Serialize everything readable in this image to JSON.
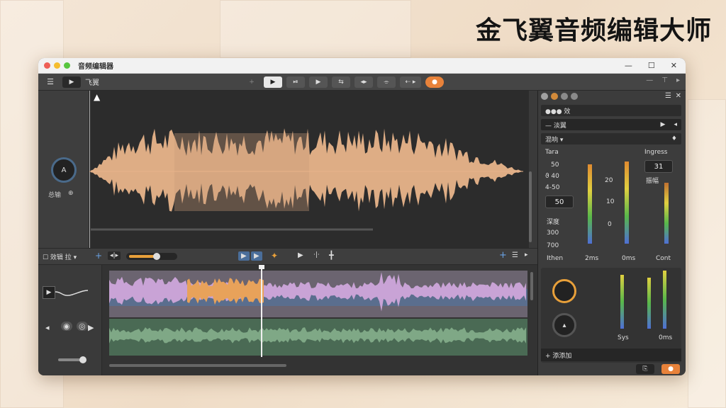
{
  "headline": "金飞翼音频编辑大师",
  "window": {
    "title": "音频编辑器",
    "controls": [
      "—",
      "☐",
      "✕"
    ],
    "traffic_colors": [
      "#ee5f57",
      "#f5bd2f",
      "#58c53e"
    ]
  },
  "toolbar": {
    "menu_icon": "☰",
    "play_icon": "▶",
    "label": "飞翼",
    "add_icon": "+",
    "tools": [
      "▶",
      "⏯",
      "▶",
      "⇆",
      "◂▸",
      "⌯",
      "⇠ ▸",
      "●"
    ],
    "right_tools": [
      "—",
      "⊤",
      "▸"
    ]
  },
  "waveform": {
    "marker_icon": "▲",
    "knob_label": "A",
    "knob_caption": "总输",
    "knob_icon": "⊕",
    "color": "#e8b48a",
    "highlight_color": "#c99a78"
  },
  "right_panel": {
    "header_dots": [
      "#a0a0a0",
      "#d28a3a",
      "#9a9a9a",
      "#9a9a9a"
    ],
    "header_icons": [
      "☰",
      "✕"
    ],
    "row1_label": "●●● 效",
    "row2_label": "— 淡翼",
    "row2_btns": [
      "▶",
      "◂"
    ],
    "row3_label": "混响 ▾",
    "row3_icon": "♦",
    "params": {
      "left_title": "Tara",
      "right_title": "Ingress",
      "v1": "50",
      "v2": "ϑ 40",
      "v3": "4-50",
      "box1": "50",
      "v4": "深度",
      "v5": "300",
      "v6": "700",
      "box2": "31",
      "box_label": "振幅"
    },
    "meter_scale": [
      "20",
      "10",
      "0"
    ],
    "meter_labels": [
      "Ithen",
      "2ms",
      "0ms",
      "Cont"
    ],
    "lower": {
      "lbls": [
        "Sys",
        "0ms"
      ],
      "knob_icon": "▴",
      "footer": "+ 添添加"
    },
    "bottom_btns": [
      "⎘",
      "●"
    ]
  },
  "midbar": {
    "checkbox_label": "☐ 效辑 拉 ▾",
    "add_icon": "+",
    "split_icon": "◂|▸",
    "play_icons": [
      "▶",
      "▶"
    ],
    "fx_icon": "✦",
    "nav_icons": [
      "▶",
      "·|·",
      "╋"
    ],
    "right_icons": [
      "+",
      "☰",
      "▸"
    ]
  },
  "tracks": {
    "left_icons": [
      "▶",
      "◂",
      "◉",
      "◎",
      "▶"
    ],
    "top_color": "#c9a3d6",
    "top_orange": "#e8a25a",
    "top_blue": "#5a6e8e",
    "bottom_color": "#7fa886",
    "playhead_color": "#f0f0f0"
  }
}
